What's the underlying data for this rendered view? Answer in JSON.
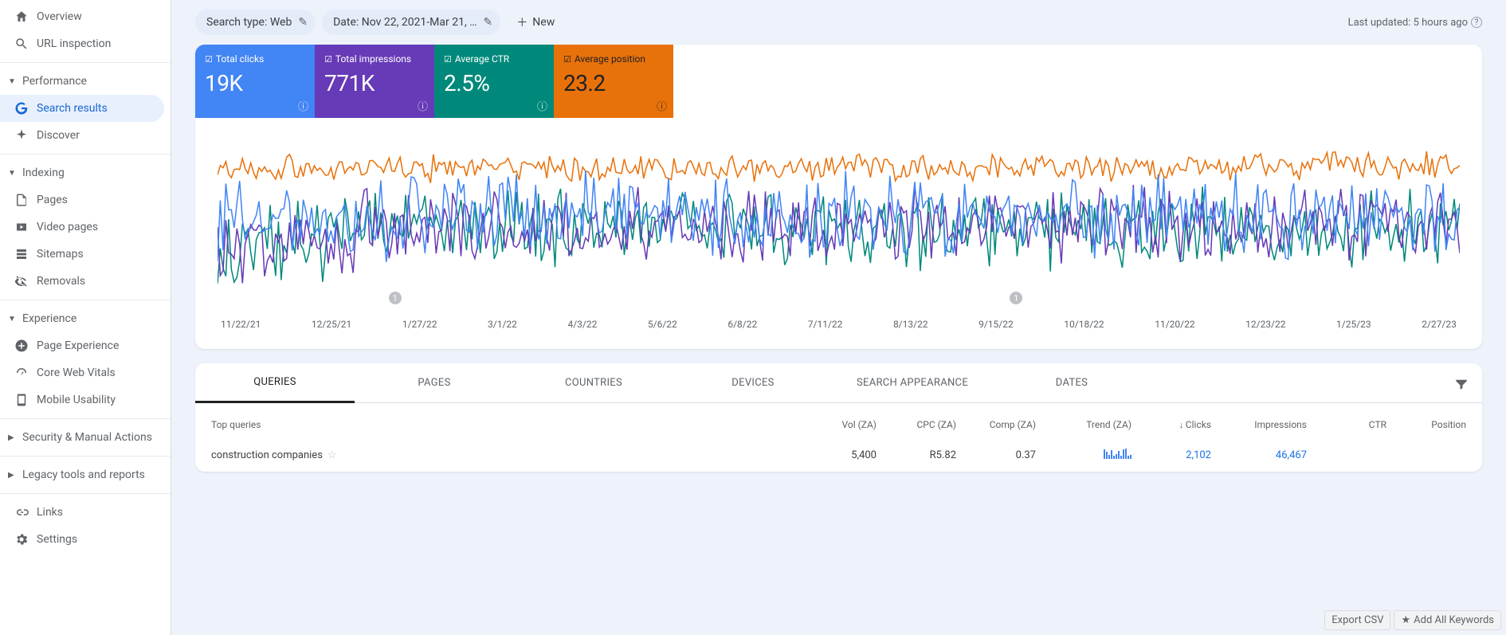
{
  "sidebar": {
    "items": [
      {
        "icon": "home",
        "label": "Overview"
      },
      {
        "icon": "search",
        "label": "URL inspection"
      }
    ],
    "sections": [
      {
        "label": "Performance",
        "items": [
          {
            "icon": "google",
            "label": "Search results",
            "active": true
          },
          {
            "icon": "discover",
            "label": "Discover"
          }
        ]
      },
      {
        "label": "Indexing",
        "items": [
          {
            "icon": "pages",
            "label": "Pages"
          },
          {
            "icon": "video",
            "label": "Video pages"
          },
          {
            "icon": "sitemap",
            "label": "Sitemaps"
          },
          {
            "icon": "remove",
            "label": "Removals"
          }
        ]
      },
      {
        "label": "Experience",
        "items": [
          {
            "icon": "pageexp",
            "label": "Page Experience"
          },
          {
            "icon": "vitals",
            "label": "Core Web Vitals"
          },
          {
            "icon": "mobile",
            "label": "Mobile Usability"
          }
        ]
      }
    ],
    "collapsed": [
      {
        "label": "Security & Manual Actions"
      },
      {
        "label": "Legacy tools and reports"
      }
    ],
    "footer": [
      {
        "icon": "links",
        "label": "Links"
      },
      {
        "icon": "settings",
        "label": "Settings"
      }
    ]
  },
  "topbar": {
    "chip1": "Search type: Web",
    "chip2": "Date: Nov 22, 2021-Mar 21, …",
    "new_label": "New",
    "last_updated": "Last updated: 5 hours ago"
  },
  "metrics": [
    {
      "label": "Total clicks",
      "value": "19K",
      "color": "blue",
      "checked": true
    },
    {
      "label": "Total impressions",
      "value": "771K",
      "color": "purple",
      "checked": true
    },
    {
      "label": "Average CTR",
      "value": "2.5%",
      "color": "teal",
      "checked": true
    },
    {
      "label": "Average position",
      "value": "23.2",
      "color": "orange",
      "checked": true
    }
  ],
  "chart_data": {
    "type": "line",
    "x_labels": [
      "11/22/21",
      "12/25/21",
      "1/27/22",
      "3/1/22",
      "4/3/22",
      "5/6/22",
      "6/8/22",
      "7/11/22",
      "8/13/22",
      "9/15/22",
      "10/18/22",
      "11/20/22",
      "12/23/22",
      "1/25/23",
      "2/27/23"
    ],
    "markers": [
      {
        "x_index": 2,
        "label": "1"
      },
      {
        "x_index": 9,
        "label": "1"
      }
    ],
    "series": [
      {
        "name": "Total clicks",
        "color": "#4285f4"
      },
      {
        "name": "Total impressions",
        "color": "#673ab7"
      },
      {
        "name": "Average CTR",
        "color": "#00897b"
      },
      {
        "name": "Average position",
        "color": "#e8710a"
      }
    ],
    "note": "Four noisy daily time-series over ~16 months; values are relative (normalized per-metric) and fluctuate day-to-day without labeled y-axis."
  },
  "tabs": [
    "QUERIES",
    "PAGES",
    "COUNTRIES",
    "DEVICES",
    "SEARCH APPEARANCE",
    "DATES"
  ],
  "active_tab": "QUERIES",
  "table": {
    "head": {
      "query": "Top queries",
      "vol": "Vol (ZA)",
      "cpc": "CPC (ZA)",
      "comp": "Comp (ZA)",
      "trend": "Trend (ZA)",
      "clicks": "Clicks",
      "impr": "Impressions",
      "ctr": "CTR",
      "pos": "Position"
    },
    "rows": [
      {
        "query": "construction companies",
        "vol": "5,400",
        "cpc": "R5.82",
        "comp": "0.37",
        "clicks": "2,102",
        "impr": "46,467"
      }
    ]
  },
  "actions": {
    "export": "Export CSV",
    "addkw": "Add All Keywords"
  }
}
